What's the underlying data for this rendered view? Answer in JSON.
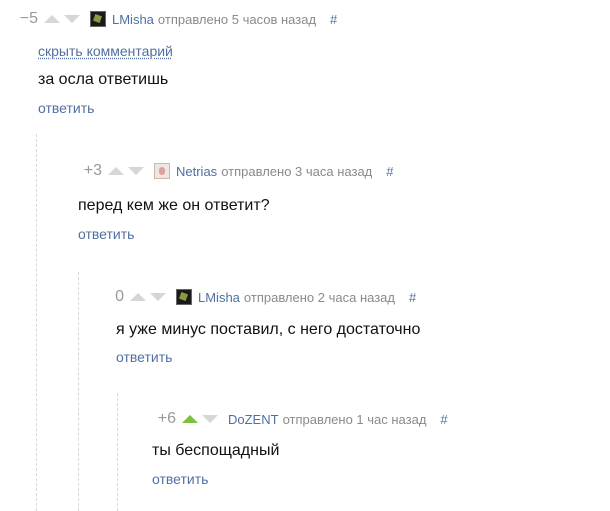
{
  "colors": {
    "link": "#4f6fa3",
    "meta": "#8a8a8a",
    "vote_inactive": "#d6d6d6",
    "vote_active": "#7cc23a",
    "text": "#111111"
  },
  "comments": [
    {
      "score": "−5",
      "avatar_icon": "dark-avatar-icon",
      "author": "LMisha",
      "posted": "отправлено 5 часов назад",
      "permalink": "#",
      "hide_label": "скрыть комментарий",
      "text": "за осла ответишь",
      "reply_label": "ответить",
      "upvoted": false
    },
    {
      "score": "+3",
      "avatar_icon": "light-avatar-icon",
      "author": "Netrias",
      "posted": "отправлено 3 часа назад",
      "permalink": "#",
      "text": "перед кем же он ответит?",
      "reply_label": "ответить",
      "upvoted": false
    },
    {
      "score": "0",
      "avatar_icon": "dark-avatar-icon",
      "author": "LMisha",
      "posted": "отправлено 2 часа назад",
      "permalink": "#",
      "text": "я уже минус поставил, с него достаточно",
      "reply_label": "ответить",
      "upvoted": false
    },
    {
      "score": "+6",
      "author": "DoZENT",
      "posted": "отправлено 1 час назад",
      "permalink": "#",
      "text": "ты беспощадный",
      "reply_label": "ответить",
      "upvoted": true
    }
  ]
}
